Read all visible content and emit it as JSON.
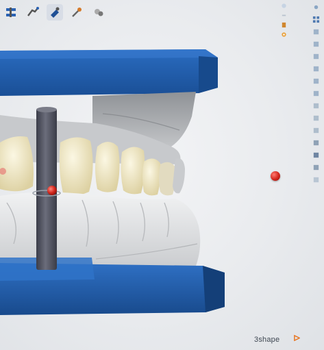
{
  "toolbar": {
    "tools": [
      {
        "icon": "articulator-icon"
      },
      {
        "icon": "model-icon"
      },
      {
        "icon": "scan-jaw-icon"
      },
      {
        "icon": "prep-tool-icon"
      },
      {
        "icon": "surface-tool-icon"
      }
    ]
  },
  "top_right_icons": [
    "eye-icon",
    "minus-icon",
    "bookmark-icon",
    "gear-icon"
  ],
  "side_panel": {
    "buttons": [
      "camera-reset-icon",
      "view-grid-icon",
      "view-front-icon",
      "view-top-icon",
      "view-left-icon",
      "view-right-icon",
      "view-back-icon",
      "view-bottom-icon",
      "occlusion-icon",
      "transparency-icon",
      "section-icon",
      "measure-icon",
      "screenshot-icon",
      "layers-icon",
      "help-icon"
    ]
  },
  "brand": {
    "text": "3shape"
  },
  "colors": {
    "articulator_blue": "#1f5ba8",
    "articulator_blue_dark": "#143f78",
    "tooth_cream": "#efe8c6",
    "model_gray": "#d6d8db",
    "pin_gray": "#4d4f5c",
    "accent_red": "#d2261c",
    "brand_orange": "#e8731d"
  }
}
